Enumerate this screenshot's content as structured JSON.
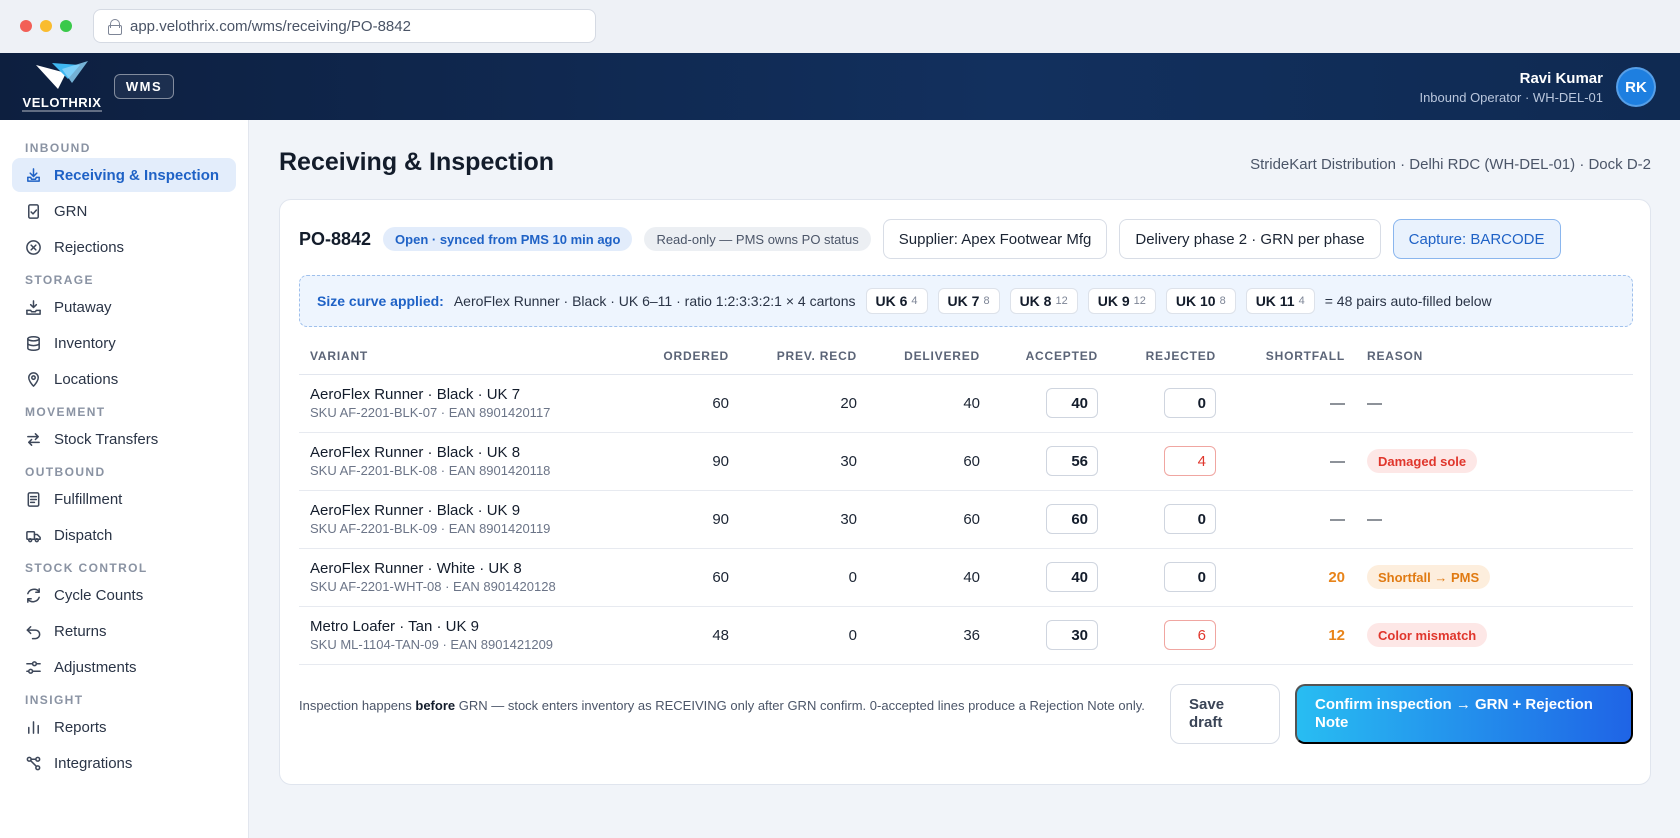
{
  "browser": {
    "url": "app.velothrix.com/wms/receiving/PO-8842",
    "dot_colors": [
      "#f25f57",
      "#f9bc2f",
      "#3ac94a"
    ]
  },
  "header": {
    "brand": "VELOTHRIX",
    "module_badge": "WMS",
    "user_name": "Ravi Kumar",
    "user_role": "Inbound Operator · WH-DEL-01",
    "avatar_initials": "RK"
  },
  "sidebar": {
    "sections": [
      {
        "title": "INBOUND",
        "items": [
          {
            "label": "Receiving & Inspection",
            "icon": "inbox-download-icon",
            "active": true
          },
          {
            "label": "GRN",
            "icon": "document-check-icon"
          },
          {
            "label": "Rejections",
            "icon": "x-circle-icon"
          }
        ]
      },
      {
        "title": "STORAGE",
        "items": [
          {
            "label": "Putaway",
            "icon": "tray-arrow-icon"
          },
          {
            "label": "Inventory",
            "icon": "database-icon"
          },
          {
            "label": "Locations",
            "icon": "map-pin-icon"
          }
        ]
      },
      {
        "title": "MOVEMENT",
        "items": [
          {
            "label": "Stock Transfers",
            "icon": "swap-arrows-icon"
          }
        ]
      },
      {
        "title": "OUTBOUND",
        "items": [
          {
            "label": "Fulfillment",
            "icon": "list-document-icon"
          },
          {
            "label": "Dispatch",
            "icon": "truck-icon"
          }
        ]
      },
      {
        "title": "STOCK CONTROL",
        "items": [
          {
            "label": "Cycle Counts",
            "icon": "refresh-icon"
          },
          {
            "label": "Returns",
            "icon": "undo-arrow-icon"
          },
          {
            "label": "Adjustments",
            "icon": "sliders-icon"
          }
        ]
      },
      {
        "title": "INSIGHT",
        "items": [
          {
            "label": "Reports",
            "icon": "bar-chart-icon"
          },
          {
            "label": "Integrations",
            "icon": "nodes-icon"
          }
        ]
      }
    ]
  },
  "page": {
    "title": "Receiving & Inspection",
    "context": "StrideKart Distribution · Delhi RDC (WH-DEL-01) · Dock D-2"
  },
  "po": {
    "id": "PO-8842",
    "status_pill": "Open · synced from PMS 10 min ago",
    "readonly_pill": "Read-only — PMS owns PO status",
    "supplier_button": "Supplier: Apex Footwear Mfg",
    "phase_button": "Delivery phase 2 · GRN per phase",
    "capture_button": "Capture: BARCODE"
  },
  "size_curve": {
    "label": "Size curve applied:",
    "description": "AeroFlex Runner · Black · UK 6–11 · ratio 1:2:3:3:2:1 × 4 cartons",
    "chips": [
      {
        "size": "UK 6",
        "qty": "4"
      },
      {
        "size": "UK 7",
        "qty": "8"
      },
      {
        "size": "UK 8",
        "qty": "12"
      },
      {
        "size": "UK 9",
        "qty": "12"
      },
      {
        "size": "UK 10",
        "qty": "8"
      },
      {
        "size": "UK 11",
        "qty": "4"
      }
    ],
    "summary": "= 48 pairs auto-filled below"
  },
  "table": {
    "columns": [
      "VARIANT",
      "ORDERED",
      "PREV. RECD",
      "DELIVERED",
      "ACCEPTED",
      "REJECTED",
      "SHORTFALL",
      "REASON"
    ],
    "rows": [
      {
        "name": "AeroFlex Runner · Black · UK 7",
        "sku": "SKU AF-2201-BLK-07 · EAN 8901420117",
        "ordered": "60",
        "prev": "20",
        "delivered": "40",
        "accepted": "40",
        "rejected": "0",
        "shortfall": "—",
        "reason": "—",
        "rejected_flag": false,
        "shortfall_flag": false,
        "reason_style": "plain"
      },
      {
        "name": "AeroFlex Runner · Black · UK 8",
        "sku": "SKU AF-2201-BLK-08 · EAN 8901420118",
        "ordered": "90",
        "prev": "30",
        "delivered": "60",
        "accepted": "56",
        "rejected": "4",
        "shortfall": "—",
        "reason": "Damaged sole",
        "rejected_flag": true,
        "shortfall_flag": false,
        "reason_style": "red"
      },
      {
        "name": "AeroFlex Runner · Black · UK 9",
        "sku": "SKU AF-2201-BLK-09 · EAN 8901420119",
        "ordered": "90",
        "prev": "30",
        "delivered": "60",
        "accepted": "60",
        "rejected": "0",
        "shortfall": "—",
        "reason": "—",
        "rejected_flag": false,
        "shortfall_flag": false,
        "reason_style": "plain"
      },
      {
        "name": "AeroFlex Runner · White · UK 8",
        "sku": "SKU AF-2201-WHT-08 · EAN 8901420128",
        "ordered": "60",
        "prev": "0",
        "delivered": "40",
        "accepted": "40",
        "rejected": "0",
        "shortfall": "20",
        "reason": "Shortfall → PMS",
        "rejected_flag": false,
        "shortfall_flag": true,
        "reason_style": "orange"
      },
      {
        "name": "Metro Loafer · Tan · UK 9",
        "sku": "SKU ML-1104-TAN-09 · EAN 8901421209",
        "ordered": "48",
        "prev": "0",
        "delivered": "36",
        "accepted": "30",
        "rejected": "6",
        "shortfall": "12",
        "reason": "Color mismatch",
        "rejected_flag": true,
        "shortfall_flag": true,
        "reason_style": "red"
      }
    ]
  },
  "footer": {
    "note_pre": "Inspection happens ",
    "note_bold": "before",
    "note_post": " GRN — stock enters inventory as RECEIVING only after GRN confirm. 0-accepted lines produce a Rejection Note only.",
    "save_button": "Save draft",
    "confirm_button": "Confirm inspection → GRN + Rejection Note"
  },
  "colors": {
    "accent": "#1f62c6",
    "header_bg": "#0d1f3f",
    "danger": "#e0362c",
    "warning": "#e8841a"
  }
}
